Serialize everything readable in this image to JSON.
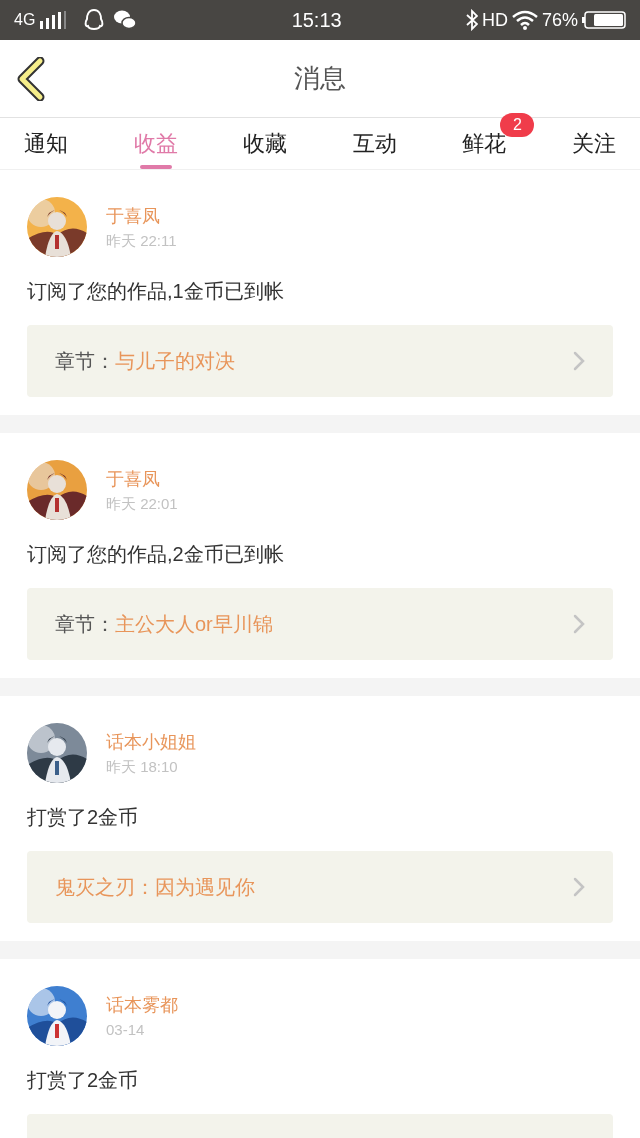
{
  "status_bar": {
    "network": "4G",
    "time": "15:13",
    "hd": "HD",
    "battery": "76%"
  },
  "header": {
    "title": "消息"
  },
  "tabs": [
    {
      "label": "通知",
      "selected": false
    },
    {
      "label": "收益",
      "selected": true
    },
    {
      "label": "收藏",
      "selected": false
    },
    {
      "label": "互动",
      "selected": false
    },
    {
      "label": "鲜花",
      "selected": false,
      "badge": "2"
    },
    {
      "label": "关注",
      "selected": false
    }
  ],
  "messages": [
    {
      "name": "于喜凤",
      "time": "昨天 22:11",
      "text": "订阅了您的作品,1金币已到帐",
      "card": {
        "label": "章节：",
        "title": "与儿子的对决"
      }
    },
    {
      "name": "于喜凤",
      "time": "昨天 22:01",
      "text": "订阅了您的作品,2金币已到帐",
      "card": {
        "label": "章节：",
        "title": "主公大人or早川锦"
      }
    },
    {
      "name": "话本小姐姐",
      "time": "昨天 18:10",
      "text": "打赏了2金币",
      "card": {
        "title": "鬼灭之刃：因为遇见你"
      }
    },
    {
      "name": "话本雾都",
      "time": "03-14",
      "text": "打赏了2金币",
      "card": {
        "kind": "cut_off"
      }
    }
  ]
}
